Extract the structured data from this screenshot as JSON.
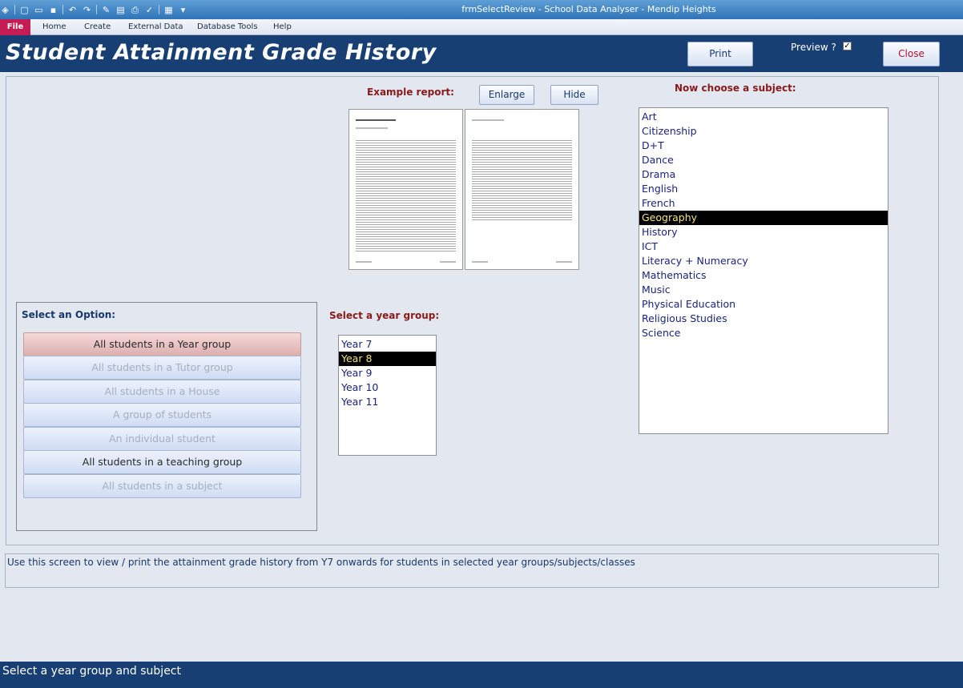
{
  "window": {
    "title": "frmSelectReview  -  School Data Analyser - Mendip Heights"
  },
  "ribbon": {
    "file": "File",
    "tabs": [
      "Home",
      "Create",
      "External Data",
      "Database Tools",
      "Help"
    ]
  },
  "header": {
    "title": "Student Attainment Grade History",
    "print_label": "Print",
    "preview_label": "Preview ?",
    "preview_checked": true,
    "close_label": "Close"
  },
  "example": {
    "label": "Example report:",
    "enlarge_label": "Enlarge",
    "hide_label": "Hide"
  },
  "subjects": {
    "label": "Now choose a subject:",
    "items": [
      "Art",
      "Citizenship",
      "D+T",
      "Dance",
      "Drama",
      "English",
      "French",
      "Geography",
      "History",
      "ICT",
      "Literacy + Numeracy",
      "Mathematics",
      "Music",
      "Physical Education",
      "Religious Studies",
      "Science"
    ],
    "selected": "Geography"
  },
  "years": {
    "label": "Select a year group:",
    "items": [
      "Year 7",
      "Year 8",
      "Year 9",
      "Year 10",
      "Year 11"
    ],
    "selected": "Year 8"
  },
  "options": {
    "title": "Select an Option:",
    "items": [
      {
        "label": "All students in a Year group",
        "state": "active"
      },
      {
        "label": "All students in a Tutor group",
        "state": "disabled"
      },
      {
        "label": "All students in a House",
        "state": "disabled"
      },
      {
        "label": "A group of students",
        "state": "disabled"
      },
      {
        "label": "An individual student",
        "state": "disabled"
      },
      {
        "label": "All students in a teaching group",
        "state": "enabled"
      },
      {
        "label": "All students in a subject",
        "state": "disabled"
      }
    ]
  },
  "info": {
    "text": "Use this screen to view / print the attainment grade history from Y7 onwards for students in selected year groups/subjects/classes"
  },
  "status": {
    "text": "Select a year group and subject"
  },
  "colors": {
    "header_bg": "#173f73",
    "file_tab": "#c41c53",
    "label_red": "#8a1a1a",
    "list_text": "#1a237e",
    "selected_text": "#f3e37c"
  }
}
